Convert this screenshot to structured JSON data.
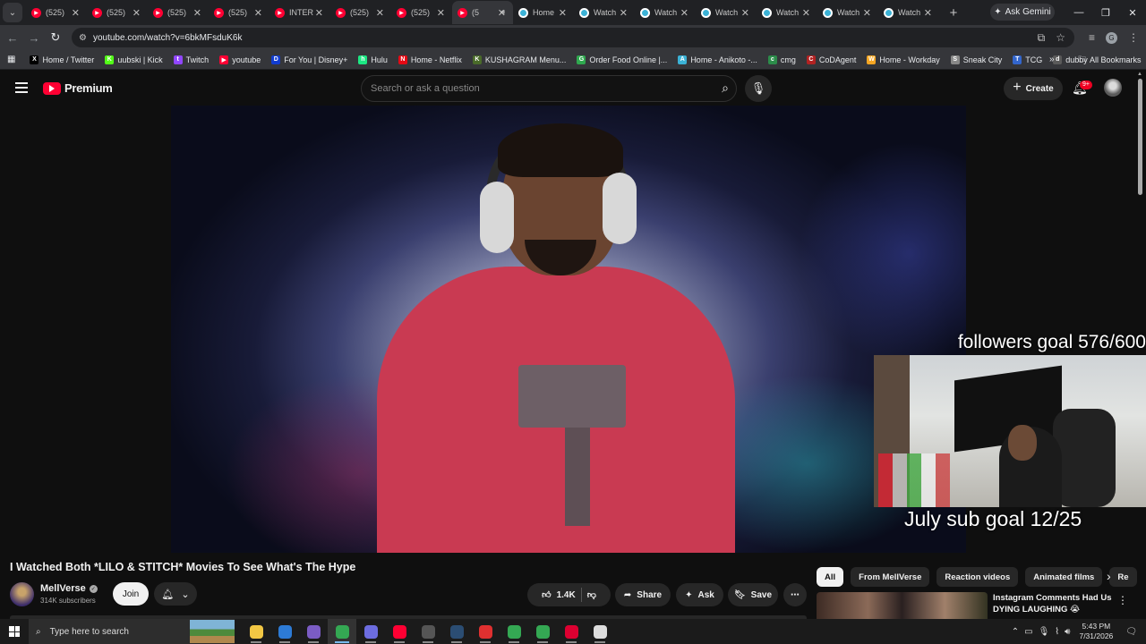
{
  "browser": {
    "tabs": [
      {
        "label": "(525)",
        "icon": "youtube"
      },
      {
        "label": "(525)",
        "icon": "youtube"
      },
      {
        "label": "(525)",
        "icon": "youtube"
      },
      {
        "label": "(525)",
        "icon": "youtube"
      },
      {
        "label": "INTER",
        "icon": "youtube"
      },
      {
        "label": "(525)",
        "icon": "youtube"
      },
      {
        "label": "(525)",
        "icon": "youtube"
      },
      {
        "label": "(5",
        "icon": "youtube",
        "active": true,
        "audio": true
      },
      {
        "label": "Home",
        "icon": "anikoto"
      },
      {
        "label": "Watch",
        "icon": "anikoto"
      },
      {
        "label": "Watch",
        "icon": "anikoto"
      },
      {
        "label": "Watch",
        "icon": "anikoto"
      },
      {
        "label": "Watch",
        "icon": "anikoto"
      },
      {
        "label": "Watch",
        "icon": "anikoto"
      },
      {
        "label": "Watch",
        "icon": "anikoto"
      }
    ],
    "gemini_label": "Ask Gemini",
    "url": "youtube.com/watch?v=6bkMFsduK6k",
    "profile_initial": "G",
    "bookmarks": [
      {
        "label": "Home / Twitter",
        "icon": "X",
        "color": "#000000"
      },
      {
        "label": "uubski | Kick",
        "icon": "K",
        "color": "#53fc18"
      },
      {
        "label": "Twitch",
        "icon": "t",
        "color": "#9146ff"
      },
      {
        "label": "youtube",
        "icon": "▶",
        "color": "#ff0033"
      },
      {
        "label": "For You | Disney+",
        "icon": "D",
        "color": "#113ccf"
      },
      {
        "label": "Hulu",
        "icon": "h",
        "color": "#1ce783"
      },
      {
        "label": "Home - Netflix",
        "icon": "N",
        "color": "#e50914"
      },
      {
        "label": "KUSHAGRAM Menu...",
        "icon": "K",
        "color": "#4a6b2a"
      },
      {
        "label": "Order Food Online |...",
        "icon": "G",
        "color": "#2fa84f"
      },
      {
        "label": "Home - Anikoto -...",
        "icon": "A",
        "color": "#3bb2d6"
      },
      {
        "label": "cmg",
        "icon": "c",
        "color": "#2c8c4a"
      },
      {
        "label": "CoDAgent",
        "icon": "C",
        "color": "#b22222"
      },
      {
        "label": "Home - Workday",
        "icon": "W",
        "color": "#f5a623"
      },
      {
        "label": "Sneak City",
        "icon": "S",
        "color": "#888888"
      },
      {
        "label": "TCG",
        "icon": "T",
        "color": "#3366cc"
      },
      {
        "label": "dubby",
        "icon": "d",
        "color": "#5a5a5a"
      }
    ],
    "all_bookmarks_label": "All Bookmarks"
  },
  "youtube": {
    "logo_text": "Premium",
    "search_placeholder": "Search or ask a question",
    "create_label": "Create",
    "notification_badge": "9+"
  },
  "overlay": {
    "followers_goal": "followers goal 576/600",
    "sub_goal": "July sub goal 12/25"
  },
  "video": {
    "title": "I Watched Both *LILO & STITCH* Movies To See What's The Hype",
    "channel": "MellVerse",
    "subscribers": "314K subscribers",
    "join_label": "Join",
    "likes": "1.4K",
    "share_label": "Share",
    "ask_label": "Ask",
    "save_label": "Save"
  },
  "sidebar": {
    "chips": [
      "All",
      "From MellVerse",
      "Reaction videos",
      "Animated films",
      "Re"
    ],
    "recommendation": {
      "title": "Instagram Comments Had Us DYING LAUGHING 😭"
    }
  },
  "taskbar": {
    "search_placeholder": "Type here to search",
    "time": "5:43 PM",
    "date": "7/31/2026",
    "apps": [
      {
        "name": "file-explorer",
        "color": "#f2c744"
      },
      {
        "name": "edge",
        "color": "#2d7bd6"
      },
      {
        "name": "discord-like",
        "color": "#7b5cc4"
      },
      {
        "name": "chrome",
        "color": "#34a853",
        "active": true
      },
      {
        "name": "game-controller",
        "color": "#6d6de0"
      },
      {
        "name": "youtube-music",
        "color": "#ff0033"
      },
      {
        "name": "obs",
        "color": "#555555"
      },
      {
        "name": "steam",
        "color": "#2b4d73"
      },
      {
        "name": "adobe",
        "color": "#e03030"
      },
      {
        "name": "chrome-2",
        "color": "#34a853"
      },
      {
        "name": "chrome-3",
        "color": "#34a853"
      },
      {
        "name": "angular",
        "color": "#dd0031"
      },
      {
        "name": "clock-app",
        "color": "#dddddd"
      }
    ]
  }
}
